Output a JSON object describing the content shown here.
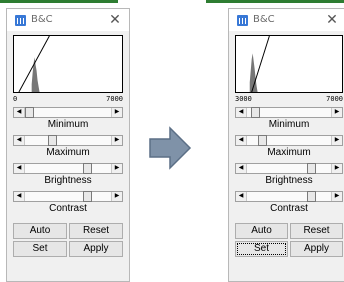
{
  "before": {
    "title": "B&C",
    "range": {
      "min": "0",
      "max": "7000"
    },
    "sliders": [
      {
        "label": "Minimum",
        "value": 0.0
      },
      {
        "label": "Maximum",
        "value": 0.3
      },
      {
        "label": "Brightness",
        "value": 0.75
      },
      {
        "label": "Contrast",
        "value": 0.75
      }
    ],
    "buttons": {
      "auto": "Auto",
      "reset": "Reset",
      "set": "Set",
      "apply": "Apply"
    }
  },
  "after": {
    "title": "B&C",
    "range": {
      "min": "3000",
      "max": "7000"
    },
    "sliders": [
      {
        "label": "Minimum",
        "value": 0.05
      },
      {
        "label": "Maximum",
        "value": 0.15
      },
      {
        "label": "Brightness",
        "value": 0.8
      },
      {
        "label": "Contrast",
        "value": 0.8
      }
    ],
    "buttons": {
      "auto": "Auto",
      "reset": "Reset",
      "set": "Set",
      "apply": "Apply"
    }
  },
  "colors": {
    "title_text": "#6a6a6a",
    "app_icon": "#3878d6",
    "arrow_fill": "#7f92a8",
    "arrow_stroke": "#5b6f86",
    "accent_green": "#2e7d32"
  }
}
